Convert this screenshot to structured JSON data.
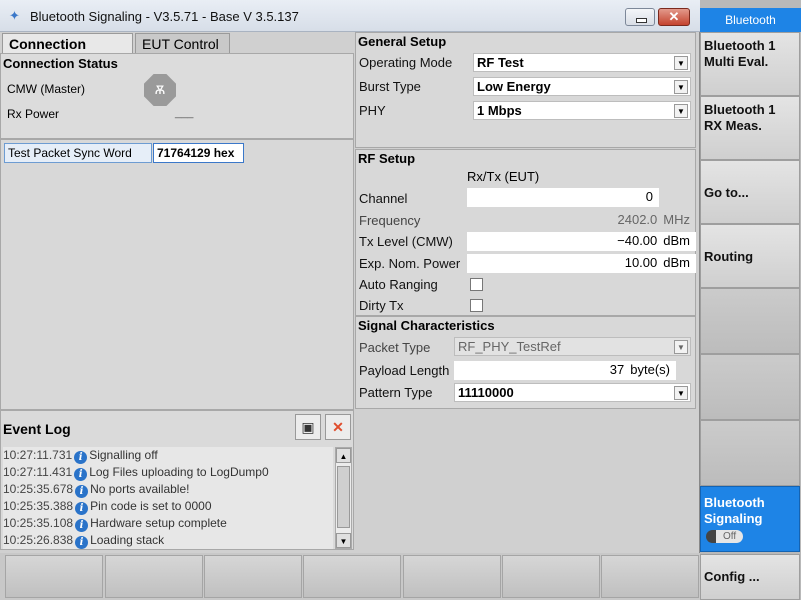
{
  "window": {
    "title": "Bluetooth Signaling  - V3.5.71 - Base V 3.5.137",
    "minimize_label": "",
    "close_label": "✕"
  },
  "tabs": [
    {
      "label": "Connection Status",
      "active": true
    },
    {
      "label": "EUT Control",
      "active": false
    }
  ],
  "connection_status": {
    "title": "Connection Status",
    "cmw_label": "CMW (Master)",
    "rx_power_label": "Rx Power",
    "rx_power_value": "___"
  },
  "sync": {
    "label": "Test Packet Sync Word",
    "value": "71764129  hex"
  },
  "general_setup": {
    "title": "General Setup",
    "operating_mode_label": "Operating Mode",
    "operating_mode_value": "RF Test",
    "burst_type_label": "Burst Type",
    "burst_type_value": "Low Energy",
    "phy_label": "PHY",
    "phy_value": "1 Mbps"
  },
  "rf_setup": {
    "title": "RF Setup",
    "column_header": "Rx/Tx (EUT)",
    "channel_label": "Channel",
    "channel_value": "0",
    "frequency_label": "Frequency",
    "frequency_value": "2402.0",
    "frequency_unit": "MHz",
    "tx_level_label": "Tx Level (CMW)",
    "tx_level_value": "−40.00",
    "tx_level_unit": "dBm",
    "exp_power_label": "Exp. Nom. Power",
    "exp_power_value": "10.00",
    "exp_power_unit": "dBm",
    "auto_ranging_label": "Auto Ranging",
    "auto_ranging_checked": false,
    "dirty_tx_label": "Dirty Tx",
    "dirty_tx_checked": false
  },
  "signal_characteristics": {
    "title": "Signal Characteristics",
    "packet_type_label": "Packet Type",
    "packet_type_value": "RF_PHY_TestRef",
    "payload_length_label": "Payload Length",
    "payload_length_value": "37",
    "payload_length_unit": "byte(s)",
    "pattern_type_label": "Pattern Type",
    "pattern_type_value": "11110000"
  },
  "event_log": {
    "title": "Event Log",
    "entries": [
      {
        "time": "10:27:11.731",
        "message": "Signalling off"
      },
      {
        "time": "10:27:11.431",
        "message": "Log Files uploading to LogDump0"
      },
      {
        "time": "10:25:35.678",
        "message": "No ports available!"
      },
      {
        "time": "10:25:35.388",
        "message": "Pin code is set to 0000"
      },
      {
        "time": "10:25:35.108",
        "message": "Hardware setup complete"
      },
      {
        "time": "10:25:26.838",
        "message": "Loading stack"
      }
    ]
  },
  "sidebar": {
    "header": "Bluetooth",
    "keys": [
      {
        "label": "Bluetooth 1 Multi Eval."
      },
      {
        "label": "Bluetooth 1 RX Meas."
      },
      {
        "label": "Go to..."
      },
      {
        "label": "Routing"
      }
    ],
    "signaling_label": "Bluetooth Signaling",
    "signaling_state": "Off",
    "config_label": "Config ..."
  },
  "colors": {
    "accent_blue": "#1e84e6",
    "close_red": "#c4432e",
    "info_blue": "#2a73c9"
  }
}
